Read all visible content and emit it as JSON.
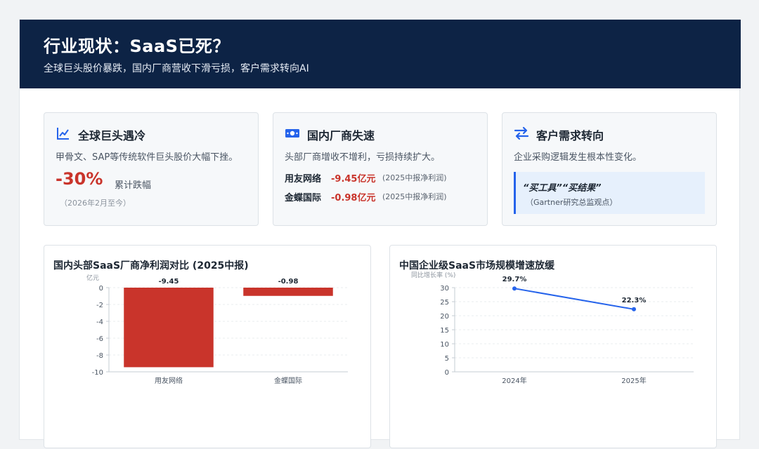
{
  "header": {
    "title": "行业现状：SaaS已死？",
    "subtitle": "全球巨头股价暴跌，国内厂商营收下滑亏损，客户需求转向AI"
  },
  "cards": [
    {
      "icon": "line-chart-icon",
      "title": "全球巨头遇冷",
      "desc": "甲骨文、SAP等传统软件巨头股价大幅下挫。",
      "big_value": "-30%",
      "big_label": "累计跌幅",
      "note": "（2026年2月至今）"
    },
    {
      "icon": "money-icon",
      "title": "国内厂商失速",
      "desc": "头部厂商增收不增利，亏损持续扩大。",
      "rows": [
        {
          "name": "用友网络",
          "value": "-9.45亿元",
          "source": "(2025中报净利润)"
        },
        {
          "name": "金蝶国际",
          "value": "-0.98亿元",
          "source": "(2025中报净利润)"
        }
      ]
    },
    {
      "icon": "swap-arrows-icon",
      "title": "客户需求转向",
      "desc": "企业采购逻辑发生根本性变化。",
      "quote": "“买工具”“买结果”",
      "quote_source": "（Gartner研究总监观点）"
    }
  ],
  "colors": {
    "header_bg": "#0d2345",
    "negative": "#c9342b",
    "accent_blue": "#2563eb",
    "bar_fill": "#c9342b"
  },
  "chart_data": [
    {
      "type": "bar",
      "title": "国内头部SaaS厂商净利润对比 (2025中报)",
      "ylabel": "亿元",
      "categories": [
        "用友网络",
        "金蝶国际"
      ],
      "values": [
        -9.45,
        -0.98
      ],
      "data_labels": [
        "-9.45",
        "-0.98"
      ],
      "ylim": [
        -10,
        0
      ],
      "yticks": [
        "0",
        "-2",
        "-4",
        "-6",
        "-8",
        "-10"
      ],
      "grid": true
    },
    {
      "type": "line",
      "title": "中国企业级SaaS市场规模增速放缓",
      "ylabel": "同比增长率 (%)",
      "x": [
        "2024年",
        "2025年"
      ],
      "values": [
        29.7,
        22.3
      ],
      "data_labels": [
        "29.7%",
        "22.3%"
      ],
      "ylim": [
        0,
        30
      ],
      "yticks": [
        "30",
        "25",
        "20",
        "15",
        "10",
        "5",
        "0"
      ],
      "grid": true
    }
  ]
}
